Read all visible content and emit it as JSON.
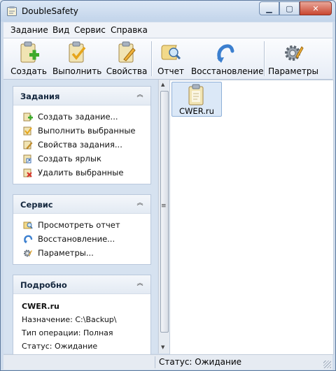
{
  "window": {
    "title": "DoubleSafety"
  },
  "menu": [
    "Задание",
    "Вид",
    "Сервис",
    "Справка"
  ],
  "toolbar": {
    "create": "Создать",
    "run": "Выполнить",
    "properties": "Свойства",
    "report": "Отчет",
    "restore": "Восстановление",
    "settings": "Параметры"
  },
  "tasks_group": {
    "title": "Задания",
    "items": [
      "Создать задание...",
      "Выполнить выбранные",
      "Свойства задания...",
      "Создать ярлык",
      "Удалить выбранные"
    ]
  },
  "service_group": {
    "title": "Сервис",
    "items": [
      "Просмотреть отчет",
      "Восстановление...",
      "Параметры..."
    ]
  },
  "details_group": {
    "title": "Подробно",
    "name": "CWER.ru",
    "destination": "Назначение: C:\\Backup\\",
    "operation": "Тип операции: Полная",
    "status": "Статус: Ожидание"
  },
  "content": {
    "items": [
      {
        "label": "CWER.ru"
      }
    ]
  },
  "statusbar": {
    "text": "Статус: Ожидание"
  }
}
